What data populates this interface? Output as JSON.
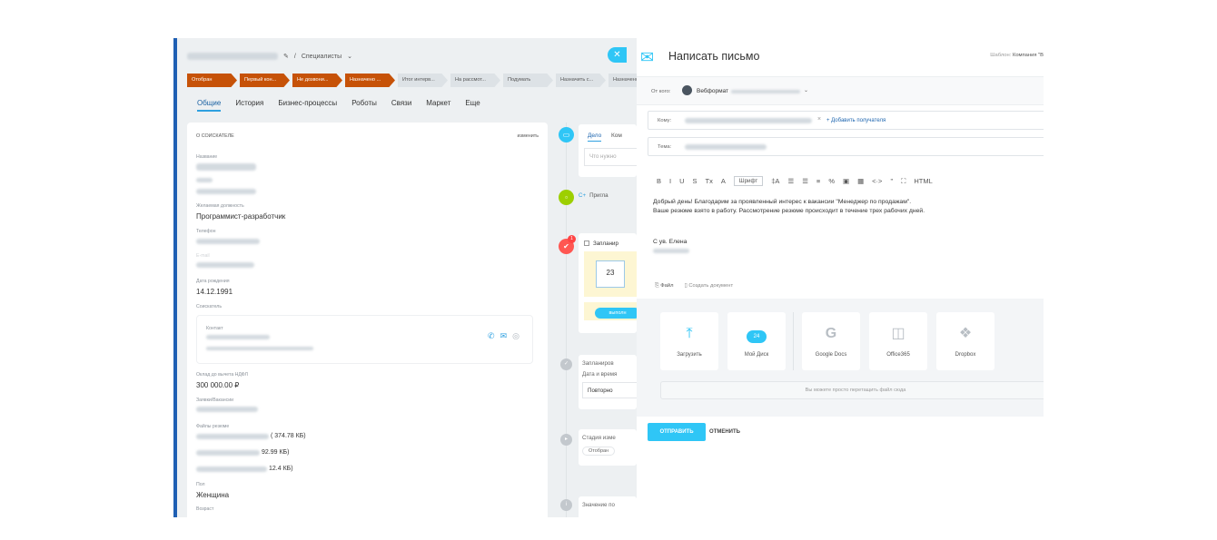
{
  "crm": {
    "breadcrumb_suffix": "Специалисты",
    "stages": [
      {
        "label": "Отобран",
        "done": true
      },
      {
        "label": "Первый кон...",
        "done": true
      },
      {
        "label": "Не дозвони...",
        "done": true
      },
      {
        "label": "Назначено ...",
        "done": true
      },
      {
        "label": "Итог интерв...",
        "done": false
      },
      {
        "label": "На рассмот...",
        "done": false
      },
      {
        "label": "Подумать",
        "done": false
      },
      {
        "label": "Назначить с...",
        "done": false
      },
      {
        "label": "Назначено",
        "done": false
      }
    ],
    "tabs": [
      "Общие",
      "История",
      "Бизнес-процессы",
      "Роботы",
      "Связи",
      "Маркет",
      "Еще"
    ],
    "card": {
      "title": "О СОИСКАТЕЛЕ",
      "edit": "изменить",
      "name_label": "Название",
      "position_label": "Желаемая должность",
      "position_value": "Программист-разработчик",
      "phone_label": "Телефон",
      "email_label": "E-mail",
      "dob_label": "Дата рождения",
      "dob_value": "14.12.1991",
      "applicant_label": "Соискатель",
      "contact_label": "Контакт",
      "salary_label": "Оклад до вычета НДФЛ",
      "salary_value": "300 000.00 ₽",
      "vacancy_label": "Заявки/Вакансии",
      "files_label": "Файлы резюме",
      "files": [
        "( 374.78 КБ)",
        "92.99 КБ)",
        "12.4 КБ)"
      ],
      "gender_label": "Пол",
      "gender_value": "Женщина",
      "age_label": "Возраст"
    },
    "timeline": {
      "tab_deal": "Дело",
      "tab_comment": "Ком",
      "placeholder": "Что нужно",
      "invite": "Пригла",
      "planned": "Запланир",
      "calendar_day": "23",
      "done_btn": "выполн",
      "planned2": "Запланиров",
      "datetime": "Дата и время",
      "repeat": "Повторно",
      "stage_change": "Стадия изме",
      "stage_from": "Отобран",
      "field_value": "Значение по",
      "badge_count": "1"
    }
  },
  "mail": {
    "title": "Написать письмо",
    "template_label": "Шаблон:",
    "template_value": "Компания \"В",
    "from_label": "От кого:",
    "from_name": "Вебформат",
    "to_label": "Кому:",
    "add_recipient": "+ Добавить получателя",
    "subject_label": "Тема:",
    "toolbar": [
      "B",
      "I",
      "U",
      "S",
      "Tx",
      "A",
      "Шрифт",
      "‡A",
      "☰",
      "☰",
      "≡",
      "%",
      "▣",
      "▦",
      "<·>",
      "\"",
      "⛶",
      "HTML"
    ],
    "body_lines": [
      "Добрый день! Благодарим за проявленный интерес к вакансии \"Менеджер по продажам\".",
      "Ваше резюме взято в работу. Рассмотрение резюме происходит в течение трех рабочих дней."
    ],
    "signature": "С ув. Елена",
    "file_label": "Файл",
    "create_doc": "Создать документ",
    "tiles": [
      {
        "label": "Загрузить",
        "icon": "upload-icon"
      },
      {
        "label": "Мой Диск",
        "icon": "cloud-24-icon"
      },
      {
        "label": "Google Docs",
        "icon": "google-icon"
      },
      {
        "label": "Office365",
        "icon": "office-icon"
      },
      {
        "label": "Dropbox",
        "icon": "dropbox-icon"
      }
    ],
    "drop_hint": "Вы можете просто перетащить файл сюда",
    "send": "ОТПРАВИТЬ",
    "cancel": "ОТМЕНИТЬ",
    "accent": "#2fc6f6"
  }
}
